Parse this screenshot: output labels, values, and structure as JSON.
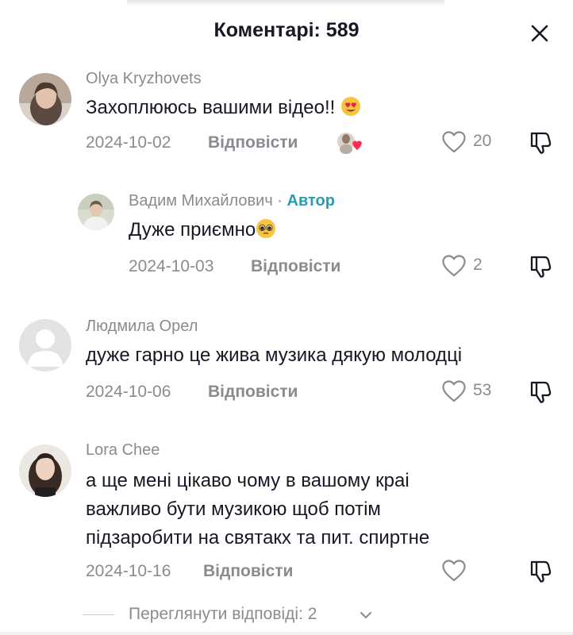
{
  "header": {
    "title": "Коментарі: 589"
  },
  "comments": [
    {
      "username": "Olya Kryzhovets",
      "text": "Захоплююсь вашими відео!!",
      "emoji": "heart-eyes-emoji",
      "date": "2024-10-02",
      "reply_label": "Відповісти",
      "likes": "20",
      "liked_by_creator": true
    },
    {
      "username": "Вадим Михайлович",
      "separator": " · ",
      "author_badge": "Автор",
      "text": "Дуже приємно",
      "emoji": "pleading-face-emoji",
      "date": "2024-10-03",
      "reply_label": "Відповісти",
      "likes": "2",
      "is_reply": true
    },
    {
      "username": "Людмила Орел",
      "text": "дуже гарно це жива музика дякую молодці",
      "date": "2024-10-06",
      "reply_label": "Відповісти",
      "likes": "53"
    },
    {
      "username": "Lora Chee",
      "text_lines": [
        "а ще мені цікаво чому в вашому краі",
        "важливо бути музикою щоб потім",
        "підзаробити на святакх та пит. спиртне"
      ],
      "date": "2024-10-16",
      "reply_label": "Відповісти",
      "likes": ""
    }
  ],
  "view_replies": {
    "label": "Переглянути відповіді: 2"
  },
  "icons": {
    "close": "close-icon",
    "like": "heart-outline-icon",
    "dislike": "thumbs-down-icon",
    "expand": "chevron-down-icon"
  },
  "colors": {
    "text": "#161823",
    "muted": "#8a8b91",
    "author_badge": "#2b9bb5"
  }
}
